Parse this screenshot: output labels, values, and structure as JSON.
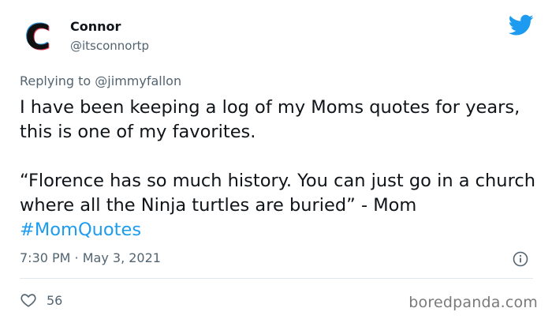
{
  "author": {
    "name": "Connor",
    "handle": "@itsconnortp",
    "avatar_letter": "C",
    "avatar_icon": "letter-c-logo-icon"
  },
  "reply": {
    "prefix": "Replying to ",
    "mention": "@jimmyfallon"
  },
  "tweet": {
    "line1": "I have been keeping a log of my Moms quotes for years, this is one of my favorites.",
    "quote": "“Florence has so much history. You can just go in a church where all the Ninja turtles are buried” - Mom ",
    "hashtag": "#MomQuotes"
  },
  "meta": {
    "time": "7:30 PM",
    "separator": " · ",
    "date": "May 3, 2021"
  },
  "engagement": {
    "likes": "56"
  },
  "watermark": "boredpanda.com",
  "colors": {
    "accent": "#1d9bf0",
    "muted": "#536471",
    "text": "#0f1419"
  },
  "icons": {
    "brand": "twitter-bird-icon",
    "info": "info-icon",
    "like": "heart-icon"
  }
}
